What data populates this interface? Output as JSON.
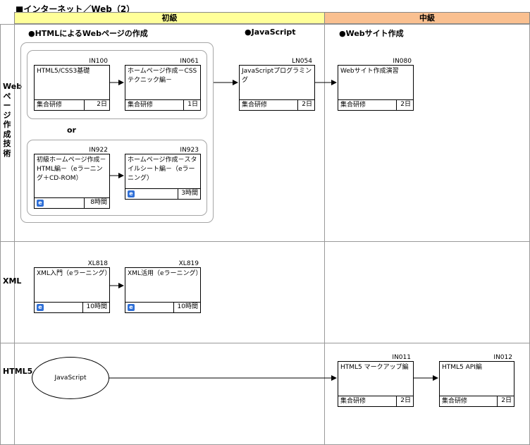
{
  "title": "■インターネット／Web（2）",
  "headers": {
    "basic": "初級",
    "intermediate": "中級"
  },
  "rows": {
    "web": "Webページ作成技術",
    "xml": "XML",
    "html5": "HTML5"
  },
  "sections": {
    "html_web": "●HTMLによるWebページの作成",
    "javascript": "●JavaScript",
    "website": "●Webサイト作成"
  },
  "or_label": "or",
  "courses": {
    "in100": {
      "code": "IN100",
      "title": "HTML5/CSS3基礎",
      "format": "集合研修",
      "duration": "2日"
    },
    "in061": {
      "code": "IN061",
      "title": "ホームページ作成－CSSテクニック編－",
      "format": "集合研修",
      "duration": "1日"
    },
    "ln054": {
      "code": "LN054",
      "title": "JavaScriptプログラミング",
      "format": "集合研修",
      "duration": "2日"
    },
    "in080": {
      "code": "IN080",
      "title": "Webサイト作成演習",
      "format": "集合研修",
      "duration": "2日"
    },
    "in922": {
      "code": "IN922",
      "title": "初級ホームページ作成－HTML編－（eラーニング＋CD-ROM）",
      "format": "e",
      "duration": "8時間"
    },
    "in923": {
      "code": "IN923",
      "title": "ホームページ作成－スタイルシート編－（eラーニング）",
      "format": "e",
      "duration": "3時間"
    },
    "xl818": {
      "code": "XL818",
      "title": "XML入門（eラーニング）",
      "format": "e",
      "duration": "10時間"
    },
    "xl819": {
      "code": "XL819",
      "title": "XML活用（eラーニング）",
      "format": "e",
      "duration": "10時間"
    },
    "in011": {
      "code": "IN011",
      "title": "HTML5 マークアップ編",
      "format": "集合研修",
      "duration": "2日"
    },
    "in012": {
      "code": "IN012",
      "title": "HTML5 API編",
      "format": "集合研修",
      "duration": "2日"
    }
  },
  "prerequisite": "JavaScript"
}
